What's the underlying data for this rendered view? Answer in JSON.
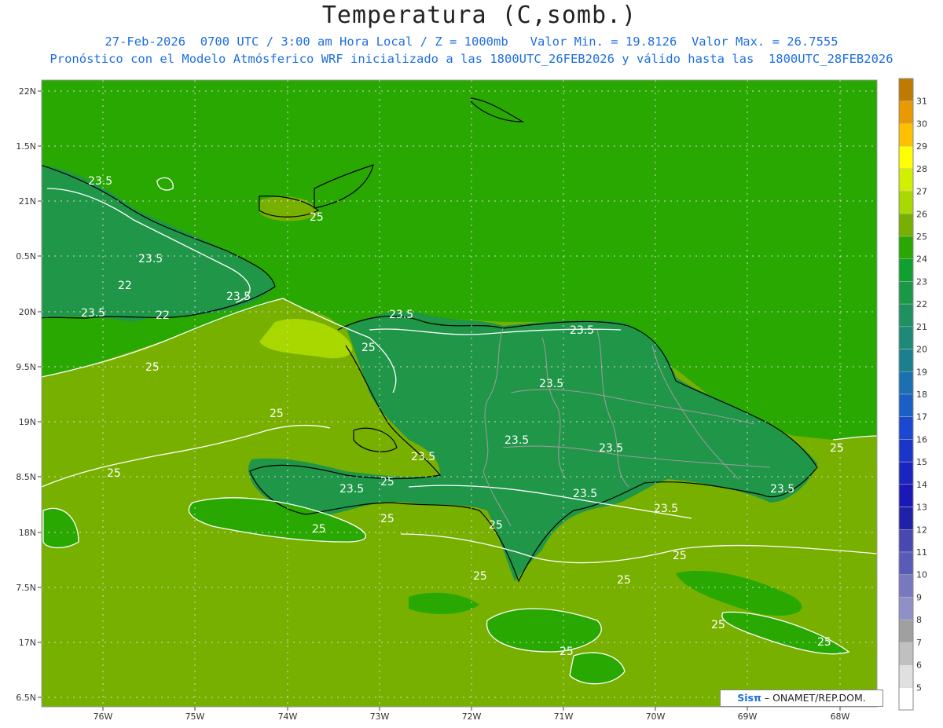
{
  "header": {
    "title": "Temperatura (C,somb.)",
    "line1": "27-Feb-2026  0700 UTC / 3:00 am Hora Local / Z = 1000mb   Valor Min. = 19.8126  Valor Max. = 26.7555",
    "line2": "Pronóstico con el Modelo Atmósferico WRF inicializado a las 1800UTC_26FEB2026 y válido hasta las  1800UTC_28FEB2026"
  },
  "axes": {
    "lat_ticks": [
      "22N",
      "1.5N",
      "21N",
      "0.5N",
      "20N",
      "9.5N",
      "19N",
      "8.5N",
      "18N",
      "7.5N",
      "17N",
      "6.5N"
    ],
    "lon_ticks": [
      "76W",
      "75W",
      "74W",
      "73W",
      "72W",
      "71W",
      "70W",
      "69W",
      "68W"
    ]
  },
  "colorbar": {
    "labels": [
      "31",
      "30",
      "29",
      "28",
      "27",
      "26",
      "25",
      "24",
      "23",
      "22",
      "21",
      "20",
      "19",
      "18",
      "17",
      "16",
      "15",
      "14",
      "13",
      "12",
      "11",
      "10",
      "9",
      "8",
      "7",
      "6",
      "5"
    ],
    "colors": [
      "#c07a00",
      "#e89a00",
      "#ffc000",
      "#ffff00",
      "#d0f000",
      "#a8d800",
      "#78b000",
      "#28a800",
      "#10a030",
      "#1a9848",
      "#1f9060",
      "#1d8a78",
      "#1a8090",
      "#1a70b0",
      "#1a5ec8",
      "#1a48d0",
      "#1a36c8",
      "#1a24c0",
      "#1a18b8",
      "#2020a8",
      "#4848b0",
      "#5a5ab8",
      "#7878c0",
      "#9090c8",
      "#a0a0a0",
      "#c0c0c0",
      "#e0e0e0",
      "#ffffff"
    ]
  },
  "contour_labels": [
    {
      "text": "23.5"
    },
    {
      "text": "23.5"
    },
    {
      "text": "22"
    },
    {
      "text": "23.5"
    },
    {
      "text": "23.5"
    },
    {
      "text": "22"
    },
    {
      "text": "25"
    },
    {
      "text": "25"
    },
    {
      "text": "23.5"
    },
    {
      "text": "25"
    },
    {
      "text": "23.5"
    },
    {
      "text": "23.5"
    },
    {
      "text": "25"
    },
    {
      "text": "25"
    },
    {
      "text": "23.5"
    },
    {
      "text": "23.5"
    },
    {
      "text": "23.5"
    },
    {
      "text": "23.5"
    },
    {
      "text": "25"
    },
    {
      "text": "25"
    },
    {
      "text": "25"
    },
    {
      "text": "25"
    },
    {
      "text": "23.5"
    },
    {
      "text": "23.5"
    },
    {
      "text": "25"
    },
    {
      "text": "25"
    },
    {
      "text": "25"
    },
    {
      "text": "25"
    },
    {
      "text": "25"
    },
    {
      "text": "25"
    },
    {
      "text": "25"
    },
    {
      "text": "23.5"
    }
  ],
  "credit": {
    "brand": "Sisπ",
    "text": " – ONAMET/REP.DOM."
  },
  "colors": {
    "sea_warm": "#78b000",
    "sea_main": "#28a800",
    "land_cool": "#1f9648",
    "warm_patch": "#a8d800",
    "subtitle": "#1f6fe0"
  }
}
